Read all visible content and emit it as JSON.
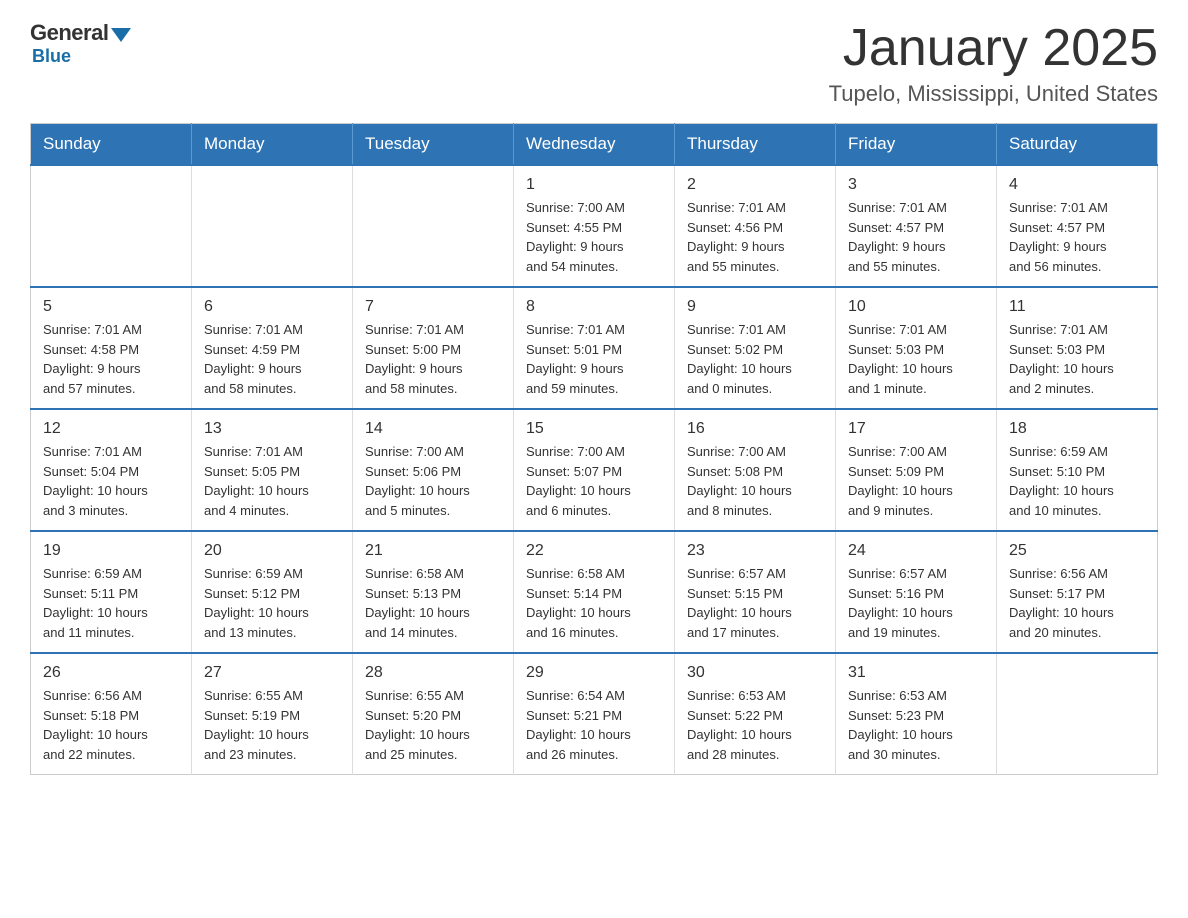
{
  "logo": {
    "general": "General",
    "blue": "Blue"
  },
  "title": "January 2025",
  "location": "Tupelo, Mississippi, United States",
  "days_of_week": [
    "Sunday",
    "Monday",
    "Tuesday",
    "Wednesday",
    "Thursday",
    "Friday",
    "Saturday"
  ],
  "weeks": [
    [
      {
        "day": "",
        "info": ""
      },
      {
        "day": "",
        "info": ""
      },
      {
        "day": "",
        "info": ""
      },
      {
        "day": "1",
        "info": "Sunrise: 7:00 AM\nSunset: 4:55 PM\nDaylight: 9 hours\nand 54 minutes."
      },
      {
        "day": "2",
        "info": "Sunrise: 7:01 AM\nSunset: 4:56 PM\nDaylight: 9 hours\nand 55 minutes."
      },
      {
        "day": "3",
        "info": "Sunrise: 7:01 AM\nSunset: 4:57 PM\nDaylight: 9 hours\nand 55 minutes."
      },
      {
        "day": "4",
        "info": "Sunrise: 7:01 AM\nSunset: 4:57 PM\nDaylight: 9 hours\nand 56 minutes."
      }
    ],
    [
      {
        "day": "5",
        "info": "Sunrise: 7:01 AM\nSunset: 4:58 PM\nDaylight: 9 hours\nand 57 minutes."
      },
      {
        "day": "6",
        "info": "Sunrise: 7:01 AM\nSunset: 4:59 PM\nDaylight: 9 hours\nand 58 minutes."
      },
      {
        "day": "7",
        "info": "Sunrise: 7:01 AM\nSunset: 5:00 PM\nDaylight: 9 hours\nand 58 minutes."
      },
      {
        "day": "8",
        "info": "Sunrise: 7:01 AM\nSunset: 5:01 PM\nDaylight: 9 hours\nand 59 minutes."
      },
      {
        "day": "9",
        "info": "Sunrise: 7:01 AM\nSunset: 5:02 PM\nDaylight: 10 hours\nand 0 minutes."
      },
      {
        "day": "10",
        "info": "Sunrise: 7:01 AM\nSunset: 5:03 PM\nDaylight: 10 hours\nand 1 minute."
      },
      {
        "day": "11",
        "info": "Sunrise: 7:01 AM\nSunset: 5:03 PM\nDaylight: 10 hours\nand 2 minutes."
      }
    ],
    [
      {
        "day": "12",
        "info": "Sunrise: 7:01 AM\nSunset: 5:04 PM\nDaylight: 10 hours\nand 3 minutes."
      },
      {
        "day": "13",
        "info": "Sunrise: 7:01 AM\nSunset: 5:05 PM\nDaylight: 10 hours\nand 4 minutes."
      },
      {
        "day": "14",
        "info": "Sunrise: 7:00 AM\nSunset: 5:06 PM\nDaylight: 10 hours\nand 5 minutes."
      },
      {
        "day": "15",
        "info": "Sunrise: 7:00 AM\nSunset: 5:07 PM\nDaylight: 10 hours\nand 6 minutes."
      },
      {
        "day": "16",
        "info": "Sunrise: 7:00 AM\nSunset: 5:08 PM\nDaylight: 10 hours\nand 8 minutes."
      },
      {
        "day": "17",
        "info": "Sunrise: 7:00 AM\nSunset: 5:09 PM\nDaylight: 10 hours\nand 9 minutes."
      },
      {
        "day": "18",
        "info": "Sunrise: 6:59 AM\nSunset: 5:10 PM\nDaylight: 10 hours\nand 10 minutes."
      }
    ],
    [
      {
        "day": "19",
        "info": "Sunrise: 6:59 AM\nSunset: 5:11 PM\nDaylight: 10 hours\nand 11 minutes."
      },
      {
        "day": "20",
        "info": "Sunrise: 6:59 AM\nSunset: 5:12 PM\nDaylight: 10 hours\nand 13 minutes."
      },
      {
        "day": "21",
        "info": "Sunrise: 6:58 AM\nSunset: 5:13 PM\nDaylight: 10 hours\nand 14 minutes."
      },
      {
        "day": "22",
        "info": "Sunrise: 6:58 AM\nSunset: 5:14 PM\nDaylight: 10 hours\nand 16 minutes."
      },
      {
        "day": "23",
        "info": "Sunrise: 6:57 AM\nSunset: 5:15 PM\nDaylight: 10 hours\nand 17 minutes."
      },
      {
        "day": "24",
        "info": "Sunrise: 6:57 AM\nSunset: 5:16 PM\nDaylight: 10 hours\nand 19 minutes."
      },
      {
        "day": "25",
        "info": "Sunrise: 6:56 AM\nSunset: 5:17 PM\nDaylight: 10 hours\nand 20 minutes."
      }
    ],
    [
      {
        "day": "26",
        "info": "Sunrise: 6:56 AM\nSunset: 5:18 PM\nDaylight: 10 hours\nand 22 minutes."
      },
      {
        "day": "27",
        "info": "Sunrise: 6:55 AM\nSunset: 5:19 PM\nDaylight: 10 hours\nand 23 minutes."
      },
      {
        "day": "28",
        "info": "Sunrise: 6:55 AM\nSunset: 5:20 PM\nDaylight: 10 hours\nand 25 minutes."
      },
      {
        "day": "29",
        "info": "Sunrise: 6:54 AM\nSunset: 5:21 PM\nDaylight: 10 hours\nand 26 minutes."
      },
      {
        "day": "30",
        "info": "Sunrise: 6:53 AM\nSunset: 5:22 PM\nDaylight: 10 hours\nand 28 minutes."
      },
      {
        "day": "31",
        "info": "Sunrise: 6:53 AM\nSunset: 5:23 PM\nDaylight: 10 hours\nand 30 minutes."
      },
      {
        "day": "",
        "info": ""
      }
    ]
  ]
}
